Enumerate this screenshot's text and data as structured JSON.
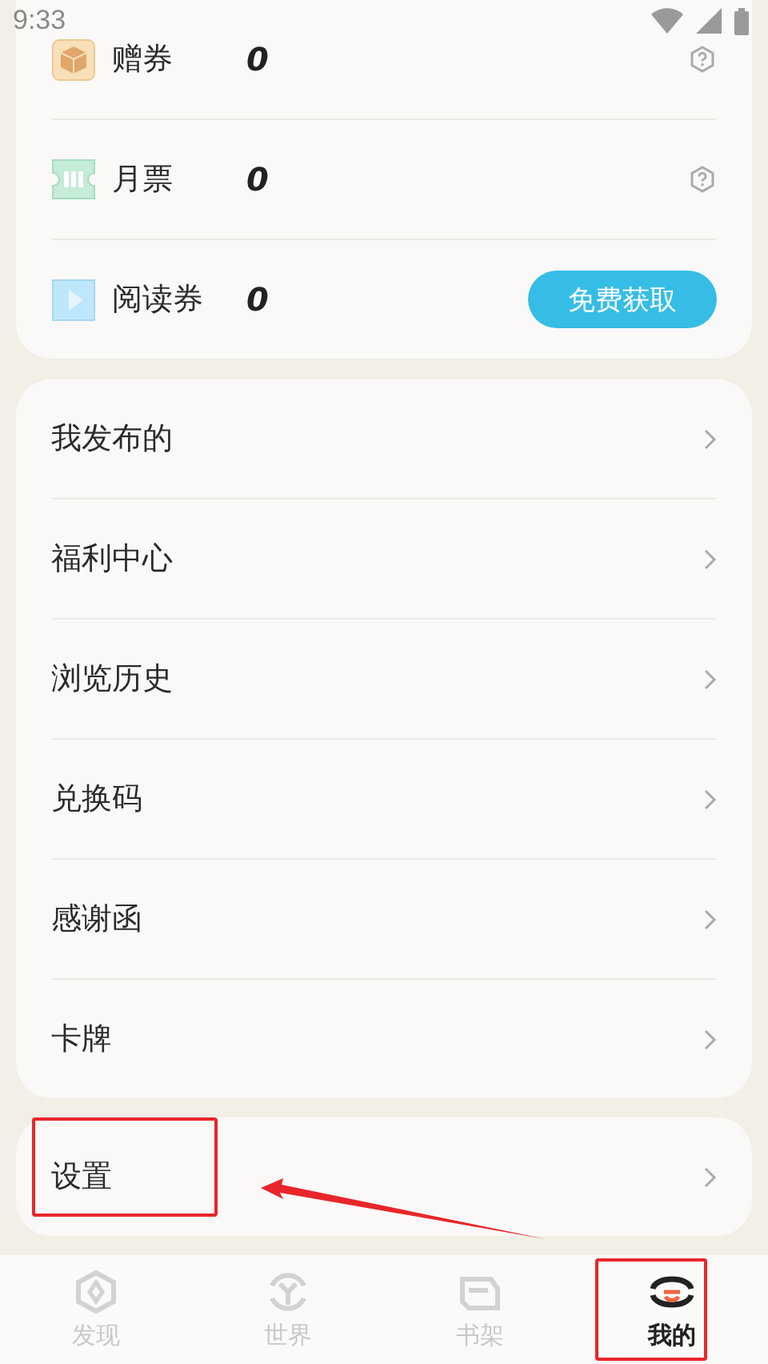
{
  "status_bar": {
    "time": "9:33"
  },
  "wallet": [
    {
      "kind": "gift",
      "label": "赠券",
      "value": "0",
      "help": true
    },
    {
      "kind": "monthly",
      "label": "月票",
      "value": "0",
      "help": true
    },
    {
      "kind": "reading",
      "label": "阅读券",
      "value": "0",
      "help": false,
      "button": "免费获取"
    }
  ],
  "menu": [
    {
      "label": "我发布的",
      "highlighted": false
    },
    {
      "label": "福利中心",
      "highlighted": false
    },
    {
      "label": "浏览历史",
      "highlighted": false
    },
    {
      "label": "兑换码",
      "highlighted": false
    },
    {
      "label": "感谢函",
      "highlighted": false
    },
    {
      "label": "卡牌",
      "highlighted": false
    }
  ],
  "settings": [
    {
      "label": "设置",
      "highlighted": true
    }
  ],
  "annotation_arrow": true,
  "tabs": [
    {
      "kind": "discover",
      "label": "发现",
      "selected": false,
      "highlighted": false
    },
    {
      "kind": "world",
      "label": "世界",
      "selected": false,
      "highlighted": false
    },
    {
      "kind": "shelf",
      "label": "书架",
      "selected": false,
      "highlighted": false
    },
    {
      "kind": "mine",
      "label": "我的",
      "selected": true,
      "highlighted": true
    }
  ]
}
